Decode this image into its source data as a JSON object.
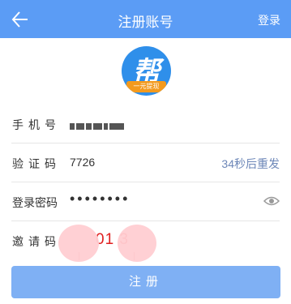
{
  "header": {
    "title": "注册账号",
    "login_label": "登录",
    "background": "#5b9cf5"
  },
  "logo": {
    "char": "帮",
    "tagline": "一元提现"
  },
  "form": {
    "phone_label": "手机号",
    "code_label": "验证码",
    "code_value": "7726",
    "countdown": "34秒后重发",
    "password_label": "登录密码",
    "password_dots": "••••••••",
    "invite_label": "邀请码",
    "invite_value": "01   3"
  },
  "register_label": "注册",
  "colors": {
    "accent": "#5b9cf5",
    "button": "#7fb0f4",
    "countdown": "#6d87b8",
    "invite": "#e02020"
  }
}
